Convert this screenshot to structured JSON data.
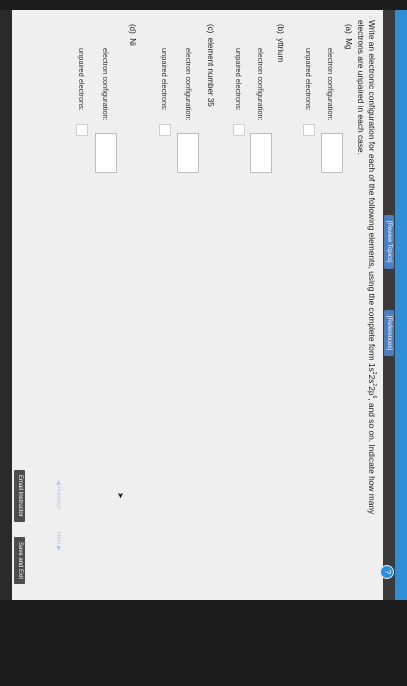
{
  "header": {
    "references_label": "[References]",
    "review_label": "[Review Topics]"
  },
  "prompt": {
    "text_start": "Write an electronic configuration for each of the following elements, using the complete form 1s",
    "sup1": "2",
    "text_mid1": "2s",
    "sup2": "2",
    "text_mid2": "2p",
    "sup3": "6",
    "text_end": ", and so on. Indicate how many electrons are unpaired in each case."
  },
  "parts": [
    {
      "letter": "(a)",
      "element": "Mg",
      "config_label": "electron configuration:",
      "unpaired_label": "unpaired electrons:"
    },
    {
      "letter": "(b)",
      "element": "yttrium",
      "config_label": "electron configuration:",
      "unpaired_label": "unpaired electrons:"
    },
    {
      "letter": "(c)",
      "element": "element number 35",
      "config_label": "electron configuration:",
      "unpaired_label": "unpaired electrons:"
    },
    {
      "letter": "(d)",
      "element": "Ni",
      "config_label": "electron configuration:",
      "unpaired_label": "unpaired electrons:"
    }
  ],
  "navigation": {
    "previous_label": "Previous",
    "next_label": "Next"
  },
  "footer": {
    "email_label": "Email Instructor",
    "save_label": "Save and Exit"
  },
  "colors": {
    "accent": "#2f8fd6",
    "page": "#efefef"
  }
}
